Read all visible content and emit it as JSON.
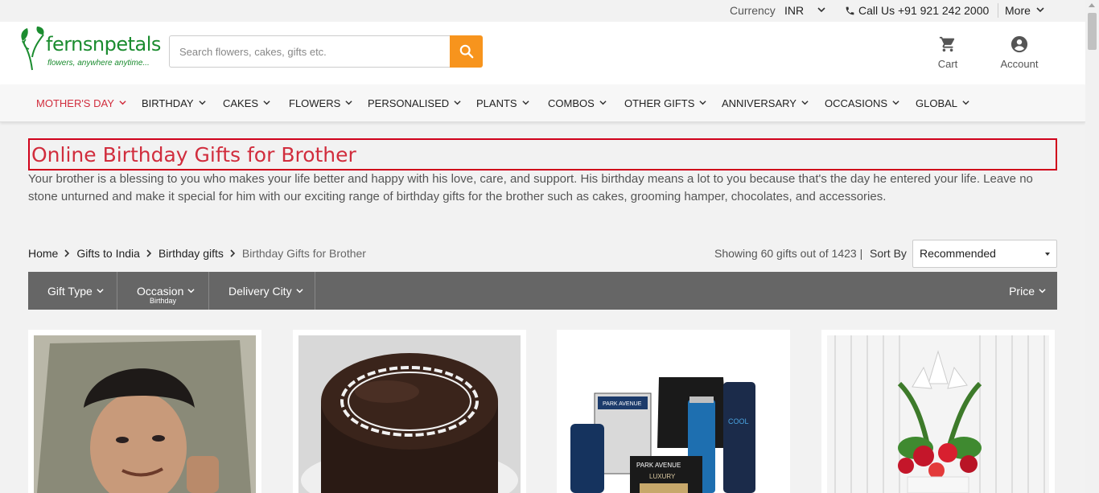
{
  "topbar": {
    "currency_label": "Currency",
    "currency_value": "INR",
    "phone": "Call Us +91 921 242 2000",
    "more": "More"
  },
  "header": {
    "logo_brand": "fernsnpetals",
    "logo_tagline": "flowers, anywhere anytime...",
    "search_placeholder": "Search flowers, cakes, gifts etc.",
    "cart_label": "Cart",
    "account_label": "Account"
  },
  "nav": {
    "items": [
      {
        "label": "MOTHER'S DAY"
      },
      {
        "label": "BIRTHDAY"
      },
      {
        "label": "CAKES"
      },
      {
        "label": "FLOWERS"
      },
      {
        "label": "PERSONALISED"
      },
      {
        "label": "PLANTS"
      },
      {
        "label": "COMBOS"
      },
      {
        "label": "OTHER GIFTS"
      },
      {
        "label": "ANNIVERSARY"
      },
      {
        "label": "OCCASIONS"
      },
      {
        "label": "GLOBAL"
      }
    ]
  },
  "page": {
    "title": "Online Birthday Gifts for Brother",
    "description": "Your brother is a blessing to you who makes your life better and happy with his love, care, and support. His birthday means a lot to you because that's the day he entered your life. Leave no stone unturned and make it special for him with our exciting range of birthday gifts for the brother such as cakes, grooming hamper, chocolates, and accessories."
  },
  "breadcrumb": [
    "Home",
    "Gifts to India",
    "Birthday gifts",
    "Birthday Gifts for Brother"
  ],
  "results": {
    "showing": "Showing 60 gifts out of 1423 |",
    "sort_label": "Sort By",
    "sort_value": "Recommended"
  },
  "filters": {
    "gift_type": "Gift Type",
    "occasion": "Occasion",
    "occasion_selected": "Birthday",
    "delivery_city": "Delivery City",
    "price": "Price"
  },
  "product_labels": {
    "grooming_brand_1": "PARK AVENUE",
    "grooming_brand_2": "PARK AVENUE",
    "grooming_sub": "LUXURY",
    "grooming_cool": "COOL"
  },
  "colors": {
    "accent": "#d12d3d",
    "search_button": "#f7941d",
    "filter_bar": "#666666",
    "logo_green": "#1b8c2f"
  }
}
